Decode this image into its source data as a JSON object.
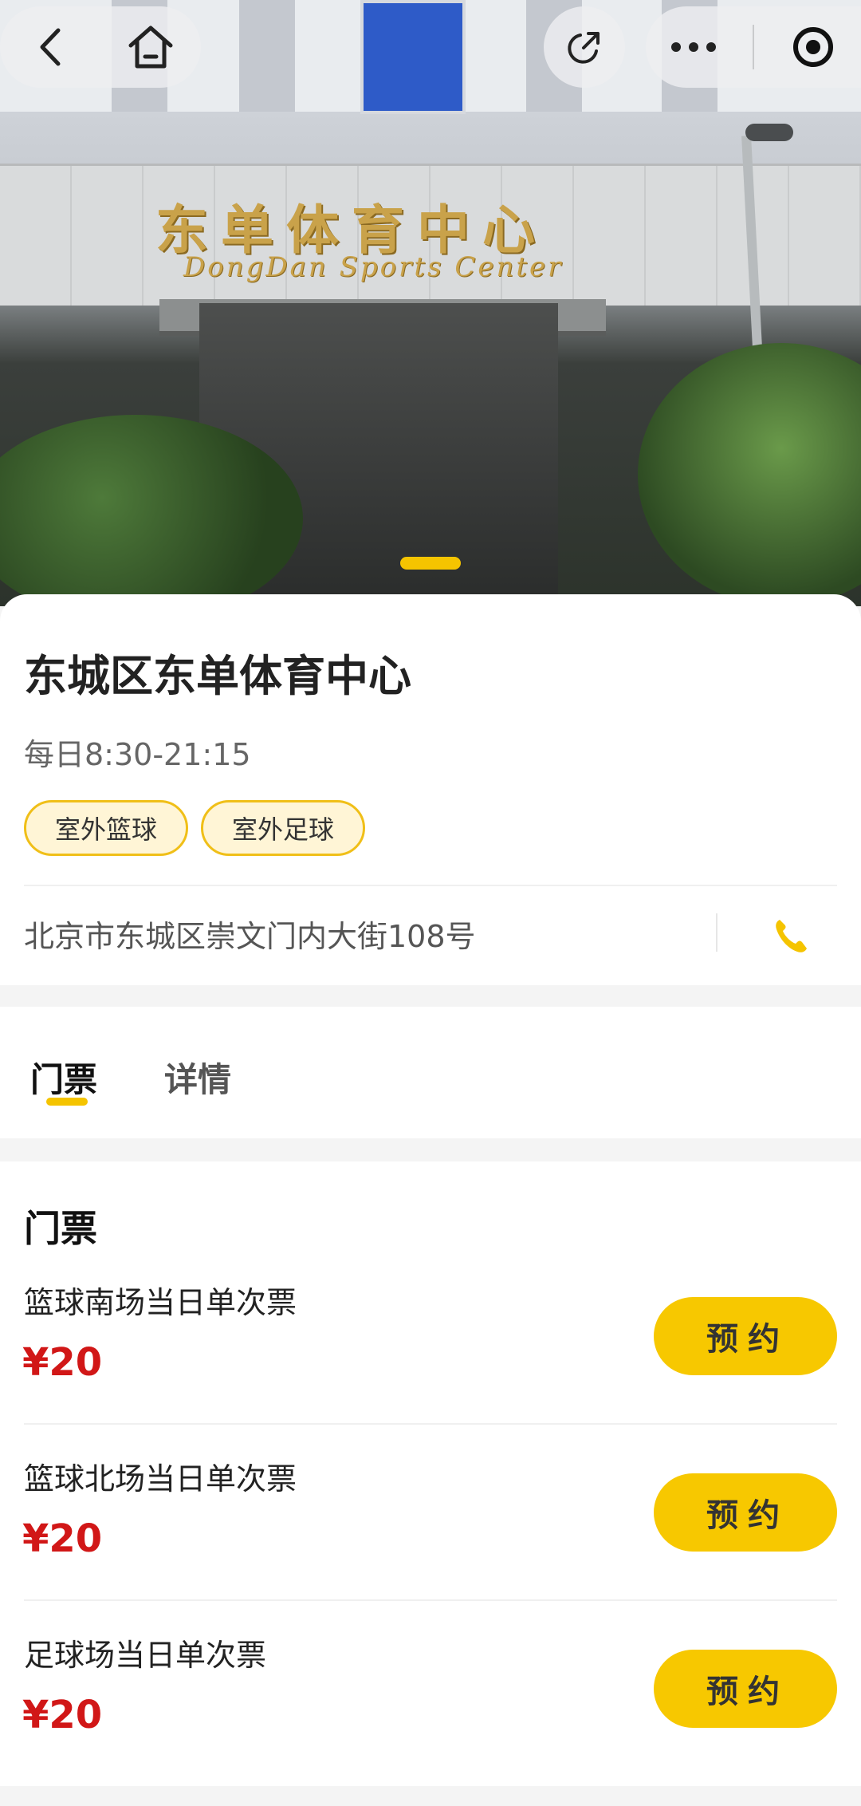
{
  "venue": {
    "name": "东城区东单体育中心",
    "hours": "每日8:30-21:15",
    "tags": [
      "室外篮球",
      "室外足球"
    ],
    "address": "北京市东城区崇文门内大街108号"
  },
  "hero": {
    "sign_cn": "东单体育中心",
    "sign_en": "DongDan Sports Center"
  },
  "nav": {
    "back_icon": "back-arrow-icon",
    "home_icon": "home-icon",
    "share_icon": "share-icon",
    "more_icon": "more-dots-icon",
    "close_icon": "miniprogram-close-icon"
  },
  "tabs": [
    {
      "label": "门票",
      "active": true
    },
    {
      "label": "详情",
      "active": false
    }
  ],
  "tickets": {
    "heading": "门票",
    "items": [
      {
        "name": "篮球南场当日单次票",
        "price": "¥20",
        "action": "预约"
      },
      {
        "name": "篮球北场当日单次票",
        "price": "¥20",
        "action": "预约"
      },
      {
        "name": "足球场当日单次票",
        "price": "¥20",
        "action": "预约"
      }
    ]
  },
  "colors": {
    "accent": "#f5c400",
    "price": "#d11717",
    "tag_bg": "#fff5d6",
    "tag_border": "#f0bf18"
  }
}
